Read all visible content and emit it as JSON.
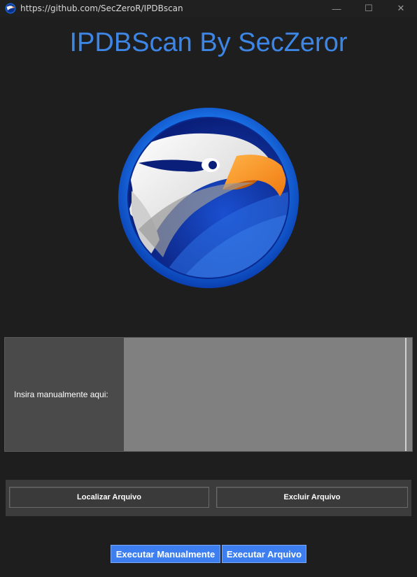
{
  "window": {
    "title": "https://github.com/SecZeroR/IPDBscan",
    "controls": {
      "minimize": "—",
      "maximize": "☐",
      "close": "✕"
    }
  },
  "header": {
    "title": "IPDBScan By SecZeror"
  },
  "logo": {
    "icon": "eagle-logo"
  },
  "manual_input": {
    "label": "Insira manualmente aqui:",
    "value": ""
  },
  "file_actions": {
    "locate_label": "Localizar Arquivo",
    "delete_label": "Excluir Arquivo"
  },
  "run_actions": {
    "run_manual_label": "Executar Manualmente",
    "run_file_label": "Executar Arquivo"
  },
  "colors": {
    "background": "#1e1e1e",
    "accent": "#3d86e5",
    "button_blue": "#3d7ff0"
  }
}
